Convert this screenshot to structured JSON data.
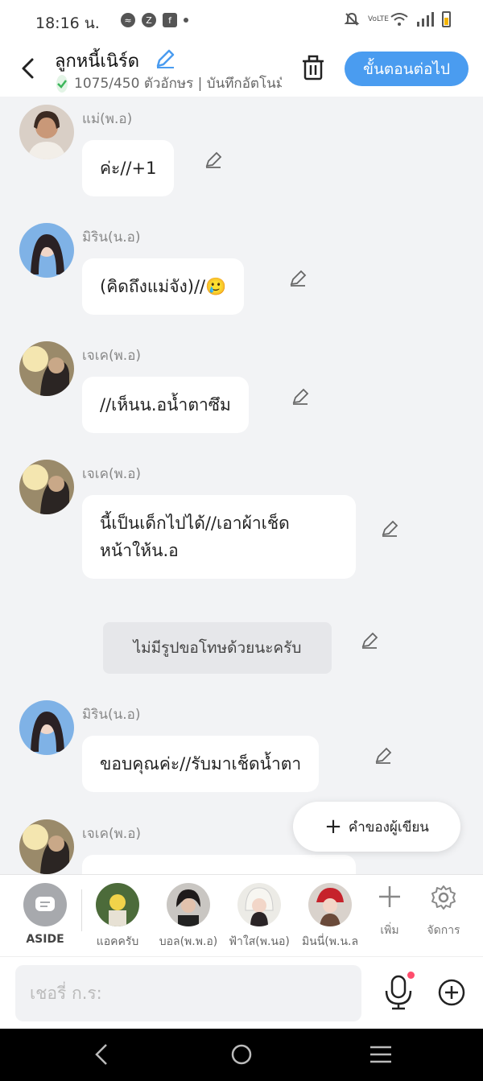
{
  "status_bar": {
    "time": "18:16 น.",
    "notification_icons": [
      "messenger-icon",
      "app-icon",
      "facebook-icon",
      "dot-icon"
    ],
    "right_icons": [
      "mute-icon",
      "volte-icon",
      "wifi-icon",
      "signal-icon",
      "battery-icon"
    ],
    "volte_label": "VoLTE"
  },
  "header": {
    "title": "ลูกหนี้เนิร์ด",
    "counter": "1075/450 ตัวอักษร | บันทึกอัตโนมัติ",
    "next_button": "ขั้นตอนต่อไป"
  },
  "messages": [
    {
      "sender": "แม่(พ.อ)",
      "text": "ค่ะ//+1",
      "avatar": "mother"
    },
    {
      "sender": "มิริน(น.อ)",
      "text": "(คิดถึงแม่จัง)//🥲",
      "avatar": "mirin"
    },
    {
      "sender": "เจเค(พ.อ)",
      "text": "//เห็นน.อน้ำตาซึม",
      "avatar": "jk"
    },
    {
      "sender": "เจเค(พ.อ)",
      "text_lines": [
        "นี้เป็นเด็กไปได้//เอาผ้าเช็ด",
        "หน้าให้น.อ"
      ],
      "avatar": "jk"
    },
    {
      "narration": "ไม่มีรูปขอโทษด้วยนะครับ"
    },
    {
      "sender": "มิริน(น.อ)",
      "text": "ขอบคุณค่ะ//รับมาเช็ดน้ำตา",
      "avatar": "mirin"
    },
    {
      "sender": "เจเค(พ.อ)",
      "text": "",
      "avatar": "jk"
    }
  ],
  "author_button": "คำของผู้เขียน",
  "characters": [
    {
      "label": "ASIDE"
    },
    {
      "label": "แอคครับ"
    },
    {
      "label": "บอล(พ.พ.อ)"
    },
    {
      "label": "ฟ้าใส(พ.นอ)"
    },
    {
      "label": "มินนี่(พ.น.ล"
    }
  ],
  "tools": {
    "add": "เพิ่ม",
    "manage": "จัดการ"
  },
  "input": {
    "placeholder": "เชอรี่ ก.ร:"
  },
  "colors": {
    "accent": "#4a9cf0",
    "background": "#f2f3f5",
    "notification_dot": "#ff4d6d"
  }
}
